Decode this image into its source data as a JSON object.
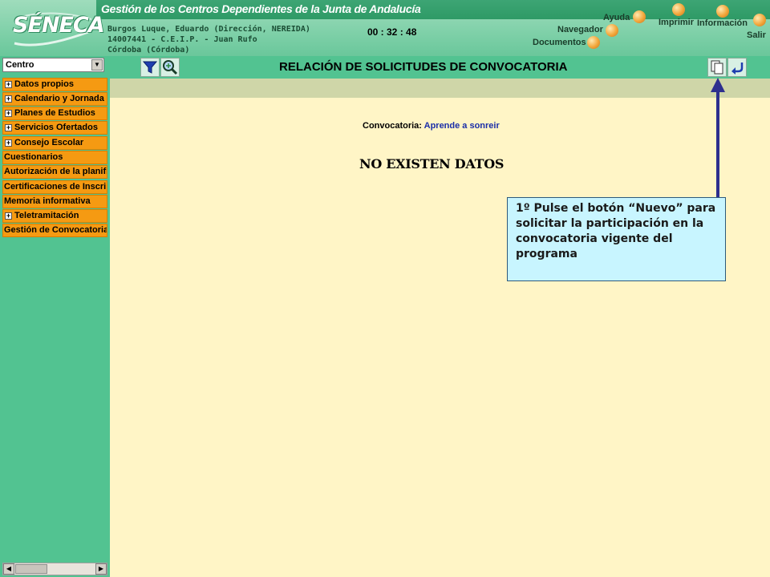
{
  "header": {
    "subtitle": "Gestión de los Centros Dependientes de  la Junta de Andalucía",
    "logo_text": "SÉNECA",
    "user_line1": "Burgos Luque, Eduardo (Dirección, NEREIDA)",
    "user_line2": "14007441 - C.E.I.P. - Juan Rufo",
    "user_line3": "Córdoba (Córdoba)",
    "timer": "00 : 32 : 48",
    "nav": {
      "ayuda": "Ayuda",
      "imprimir": "Imprimir",
      "informacion": "Información",
      "salir": "Salir",
      "navegador": "Navegador",
      "documentos": "Documentos"
    },
    "accent": "#f2a63a"
  },
  "sidebar": {
    "select_value": "Centro",
    "items": [
      {
        "label": "Datos propios",
        "expandable": true
      },
      {
        "label": "Calendario y Jornada",
        "expandable": true
      },
      {
        "label": "Planes de Estudios",
        "expandable": true
      },
      {
        "label": "Servicios Ofertados",
        "expandable": true
      },
      {
        "label": "Consejo Escolar",
        "expandable": true
      },
      {
        "label": "Cuestionarios",
        "expandable": false
      },
      {
        "label": "Autorización de la planifi",
        "expandable": false
      },
      {
        "label": "Certificaciones de Inscri",
        "expandable": false
      },
      {
        "label": "Memoria informativa",
        "expandable": false
      },
      {
        "label": "Teletramitación",
        "expandable": true
      },
      {
        "label": "Gestión de Convocatoria",
        "expandable": false
      }
    ],
    "plus_glyph": "+",
    "scroll_left": "◀",
    "scroll_right": "▶",
    "select_arrow": "▼"
  },
  "main": {
    "title": "RELACIÓN DE SOLICITUDES DE CONVOCATORIA",
    "convocatoria_label": "Convocatoria:",
    "convocatoria_value": "Aprende a sonreir",
    "no_data": "NO EXISTEN DATOS"
  },
  "callout": {
    "text": "1º Pulse el botón “Nuevo” para solicitar la participación en la convocatoria vigente del programa"
  },
  "icons": [
    "filter-icon",
    "search-zoom-icon",
    "new-document-icon",
    "back-icon"
  ]
}
